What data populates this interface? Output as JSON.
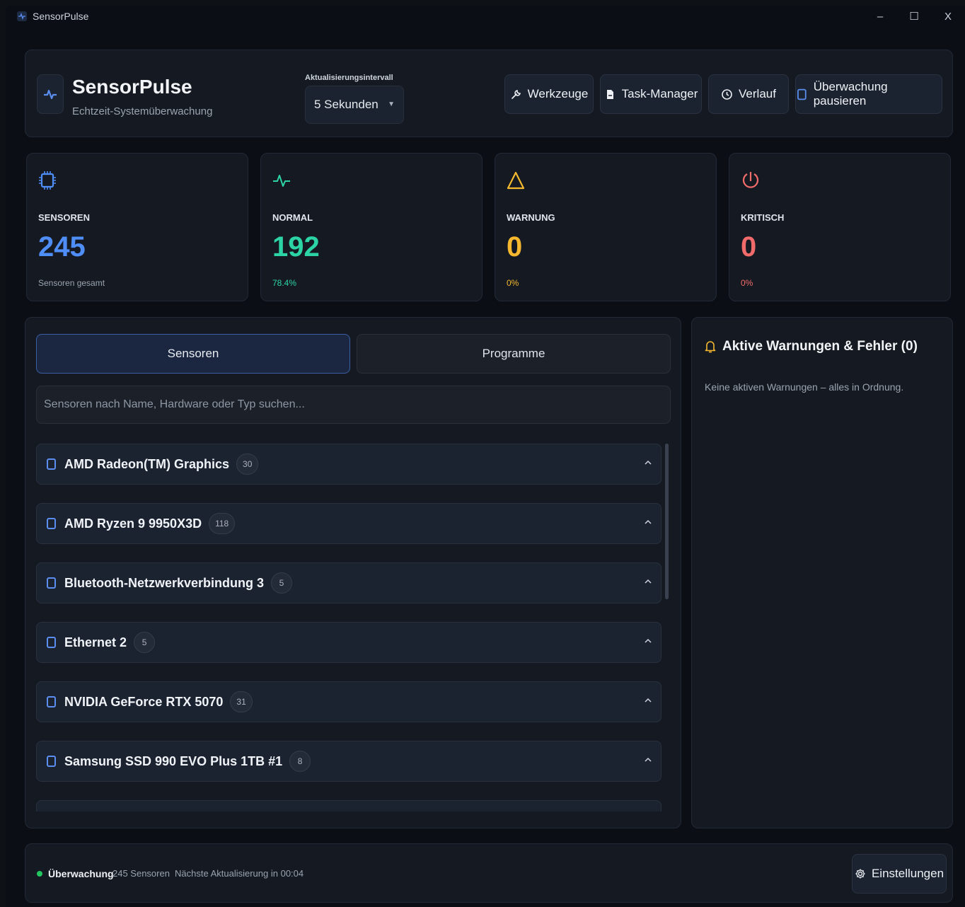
{
  "window": {
    "title": "SensorPulse",
    "controls": {
      "minimize": "–",
      "maximize": "☐",
      "close": "X"
    }
  },
  "header": {
    "brand": "SensorPulse",
    "subtitle": "Echtzeit-Systemüberwachung",
    "interval_label": "Aktualisierungsintervall",
    "interval_value": "5 Sekunden",
    "buttons": {
      "tools": "Werkzeuge",
      "task_manager": "Task-Manager",
      "history": "Verlauf",
      "pause": "Überwachung pausieren"
    }
  },
  "stats": [
    {
      "label": "SENSOREN",
      "value": "245",
      "sub": "Sensoren gesamt",
      "color": "#4f8df7",
      "sub_color": "#9aa3b0"
    },
    {
      "label": "NORMAL",
      "value": "192",
      "sub": "78.4%",
      "color": "#2dd4a3",
      "sub_color": "#2dd4a3"
    },
    {
      "label": "WARNUNG",
      "value": "0",
      "sub": "0%",
      "color": "#f5b82e",
      "sub_color": "#f5b82e"
    },
    {
      "label": "KRITISCH",
      "value": "0",
      "sub": "0%",
      "color": "#f26b6b",
      "sub_color": "#f26b6b"
    }
  ],
  "tabs": {
    "sensors": "Sensoren",
    "programs": "Programme"
  },
  "search": {
    "placeholder": "Sensoren nach Name, Hardware oder Typ suchen..."
  },
  "groups": [
    {
      "name": "AMD Radeon(TM) Graphics",
      "count": "30"
    },
    {
      "name": "AMD Ryzen 9 9950X3D",
      "count": "118"
    },
    {
      "name": "Bluetooth-Netzwerkverbindung 3",
      "count": "5"
    },
    {
      "name": "Ethernet 2",
      "count": "5"
    },
    {
      "name": "NVIDIA GeForce RTX 5070",
      "count": "31"
    },
    {
      "name": "Samsung SSD 990 EVO Plus 1TB #1",
      "count": "8"
    }
  ],
  "warnings": {
    "title": "Aktive Warnungen & Fehler (0)",
    "empty": "Keine aktiven Warnungen – alles in Ordnung."
  },
  "footer": {
    "status": "Überwachung",
    "count": "245 Sensoren",
    "next": "Nächste Aktualisierung in 00:04",
    "settings": "Einstellungen"
  },
  "colors": {
    "accent": "#4f8df7",
    "ok": "#22c55e",
    "warning": "#f5b82e",
    "critical": "#f26b6b"
  }
}
